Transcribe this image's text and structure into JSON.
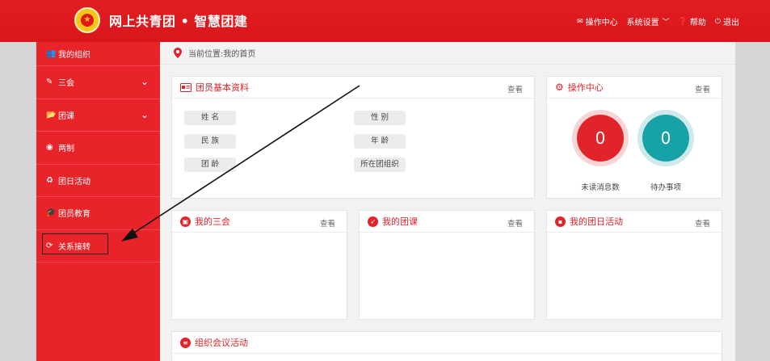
{
  "header": {
    "brand": "网上共青团 • 智慧团建",
    "nav": [
      {
        "icon": "envelope-icon",
        "label": "操作中心"
      },
      {
        "icon": "settings-icon",
        "label": "系统设置"
      },
      {
        "icon": "help-icon",
        "label": "帮助"
      },
      {
        "icon": "power-icon",
        "label": "退出"
      }
    ]
  },
  "sidebar": {
    "items": [
      {
        "label": "我的组织"
      },
      {
        "label": "三会"
      },
      {
        "label": "团课"
      },
      {
        "label": "两制"
      },
      {
        "label": "团日活动"
      },
      {
        "label": "团员教育"
      },
      {
        "label": "关系接转"
      }
    ]
  },
  "breadcrumb": "当前位置:我的首页",
  "profile": {
    "title": "团员基本资料",
    "more": "查看",
    "fields": [
      "姓 名",
      "性 别",
      "民 族",
      "年 龄",
      "团 龄",
      "所在团组织"
    ]
  },
  "ops": {
    "title": "操作中心",
    "more": "查看",
    "unread_count": "0",
    "unread_label": "未读消息数",
    "todo_count": "0",
    "todo_label": "待办事项"
  },
  "meetings": {
    "title": "我的三会",
    "more": "查看"
  },
  "courses": {
    "title": "我的团课",
    "more": "查看"
  },
  "activities": {
    "title": "我的团日活动",
    "more": "查看"
  },
  "org_meetings": {
    "title": "组织会议活动"
  },
  "colors": {
    "primary_red": "#e1232a",
    "teal": "#17a2a8"
  }
}
